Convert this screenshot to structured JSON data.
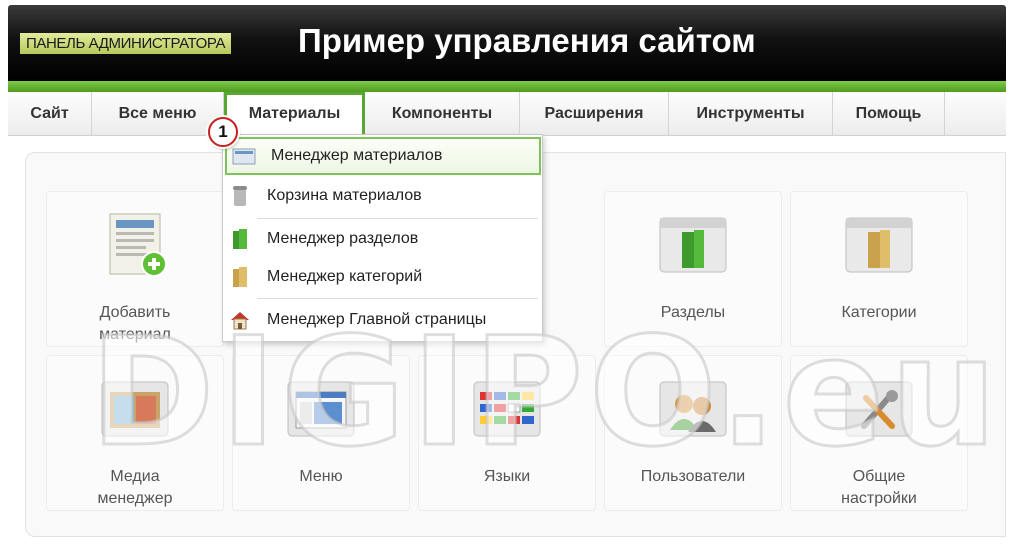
{
  "header": {
    "brand": "ПАНЕЛЬ АДМИНИСТРАТОРА",
    "title": "Пример управления сайтом"
  },
  "menu": {
    "items": [
      {
        "label": "Сайт"
      },
      {
        "label": "Все меню"
      },
      {
        "label": "Материалы"
      },
      {
        "label": "Компоненты"
      },
      {
        "label": "Расширения"
      },
      {
        "label": "Инструменты"
      },
      {
        "label": "Помощь"
      }
    ],
    "active": "Материалы"
  },
  "annotation_badge": "1",
  "dropdown": {
    "items": [
      {
        "label": "Менеджер материалов",
        "icon": "articles-icon",
        "selected": true
      },
      {
        "label": "Корзина материалов",
        "icon": "trash-icon"
      },
      {
        "label": "Менеджер разделов",
        "icon": "sections-icon"
      },
      {
        "label": "Менеджер категорий",
        "icon": "categories-icon"
      },
      {
        "label": "Менеджер Главной страницы",
        "icon": "home-icon"
      }
    ]
  },
  "tiles": [
    {
      "label_lines": [
        "Добавить",
        "материал"
      ],
      "icon": "add-article-icon"
    },
    {
      "label_lines": [
        "Разделы"
      ],
      "icon": "sections-folder-icon"
    },
    {
      "label_lines": [
        "Категории"
      ],
      "icon": "categories-folder-icon"
    },
    {
      "label_lines": [
        "Медиа",
        "менеджер"
      ],
      "icon": "media-manager-icon"
    },
    {
      "label_lines": [
        "Меню"
      ],
      "icon": "menu-icon"
    },
    {
      "label_lines": [
        "Языки"
      ],
      "icon": "languages-icon"
    },
    {
      "label_lines": [
        "Пользователи"
      ],
      "icon": "users-icon"
    },
    {
      "label_lines": [
        "Общие",
        "настройки"
      ],
      "icon": "settings-icon"
    }
  ],
  "watermark": "DIGIPO.eu",
  "colors": {
    "accent": "#5aa632",
    "header_bg": "#000000",
    "annotation": "#c82020"
  }
}
